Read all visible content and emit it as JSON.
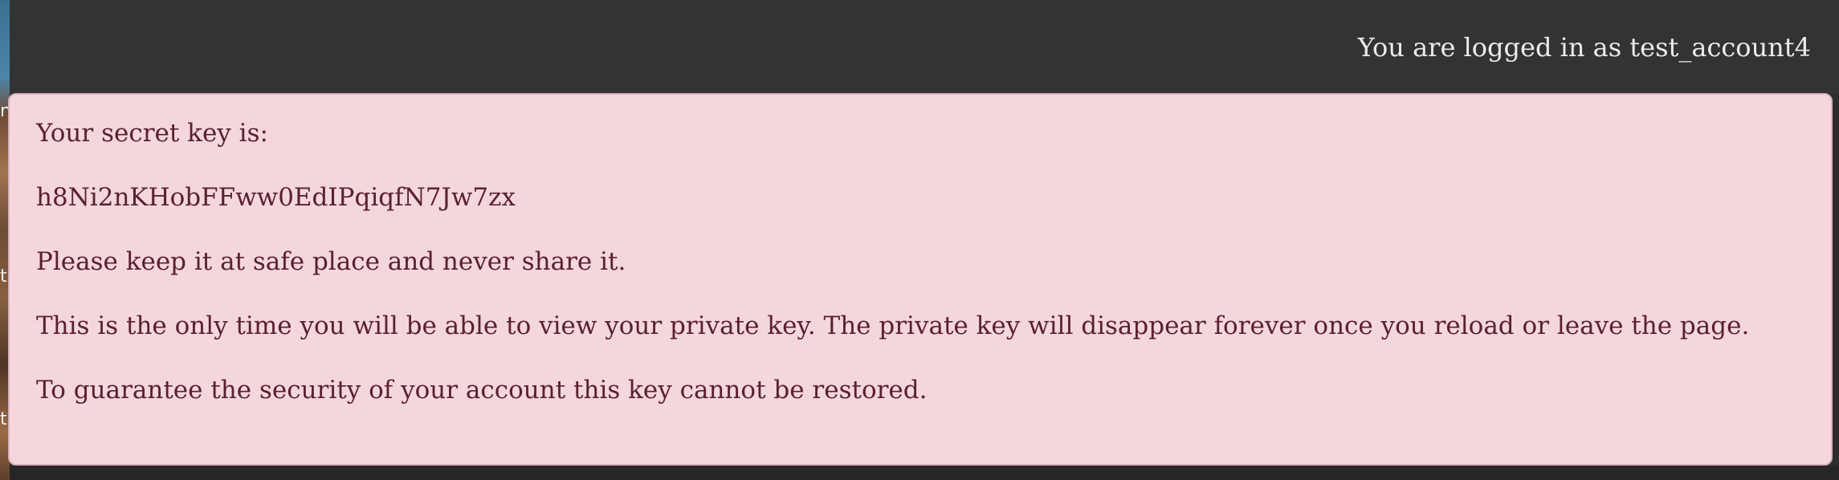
{
  "header": {
    "login_status": "You are logged in as test_account4"
  },
  "alert": {
    "intro": "Your secret key is:",
    "secret_key": "h8Ni2nKHobFFww0EdIPqiqfN7Jw7zx",
    "warning_safe": "Please keep it at safe place and never share it.",
    "warning_once": "This is the only time you will be able to view your private key. The private key will disappear forever once you reload or leave the page.",
    "warning_restore": "To guarantee the security of your account this key cannot be restored."
  },
  "background": {
    "edge_glyphs": [
      "n",
      "t",
      "t"
    ]
  }
}
